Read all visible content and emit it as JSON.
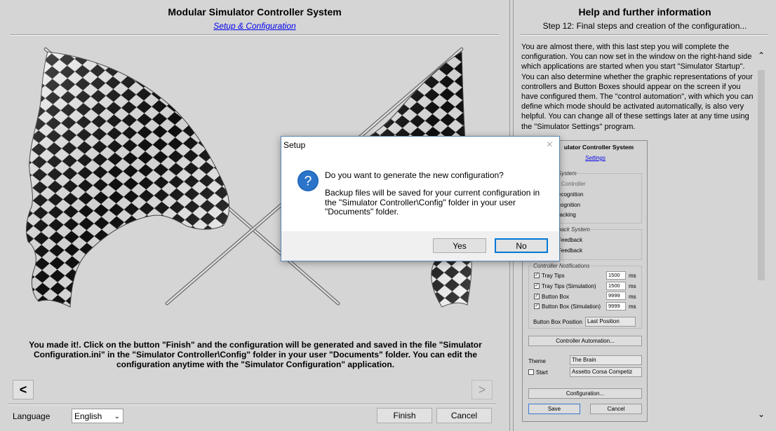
{
  "left": {
    "title": "Modular Simulator Controller System",
    "subtitle_link": "Setup & Configuration",
    "body_text": "You made it!. Click on the button \"Finish\" and the configuration will be generated and saved in the file \"Simulator Configuration.ini\" in the \"Simulator Controller\\Config\" folder in your user \"Documents\" folder. You can edit the configuration anytime with the \"Simulator Configuration\" application.",
    "prev_icon": "<",
    "next_icon": ">",
    "language_label": "Language",
    "language_value": "English",
    "finish_label": "Finish",
    "cancel_label": "Cancel"
  },
  "right": {
    "title": "Help and further information",
    "step": "Step 12: Final steps and creation of the configuration...",
    "help_text": "You are almost there, with this last step you will complete the configuration. You can now set in the window on the right-hand side which applications are started when you start \"Simulator Startup\". You can also determine whether the graphic representations of your controllers and Button Boxes should appear on the screen if you have configured them. The \"control automation\", with which you can define which mode should be activated automatically, is also very helpful. You can change all of these settings later at any time using the \"Simulator Settings\" program."
  },
  "mini": {
    "title": "ulator Controller System",
    "link": "Settings",
    "group1": "System",
    "g1_items": [
      "r Controller",
      "ecognition",
      "cognition",
      "racking"
    ],
    "group2": "back System",
    "g2_items": [
      "Feedback",
      "Feedback"
    ],
    "group3": "Controller Notifications",
    "notifications": [
      {
        "label": "Tray Tips",
        "value": "1500",
        "unit": "ms"
      },
      {
        "label": "Tray Tips (Simulation)",
        "value": "1500",
        "unit": "ms"
      },
      {
        "label": "Button Box",
        "value": "9999",
        "unit": "ms"
      },
      {
        "label": "Button Box (Simulation)",
        "value": "9999",
        "unit": "ms"
      }
    ],
    "bbpos_label": "Button Box Position",
    "bbpos_value": "Last Position",
    "automation_btn": "Controller Automation...",
    "theme_label": "Theme",
    "theme_value": "The Brain",
    "start_label": "Start",
    "start_value": "Assetto Corsa Competiz",
    "configuration_btn": "Configuration...",
    "save_btn": "Save",
    "cancel_btn": "Cancel"
  },
  "dialog": {
    "title": "Setup",
    "close": "×",
    "question": "Do you want to generate the new configuration?",
    "detail": "Backup files will be saved for your current configuration in the \"Simulator Controller\\Config\" folder in your user \"Documents\" folder.",
    "yes_label": "Yes",
    "no_label": "No"
  }
}
